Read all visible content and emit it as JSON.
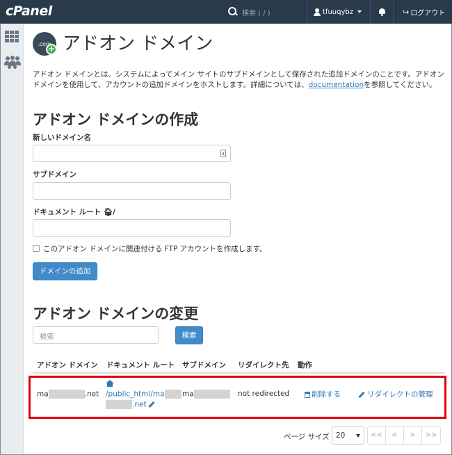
{
  "header": {
    "logo": "cPanel",
    "search_placeholder": "検索 ( / )",
    "username": "tfuuqybz",
    "logout_label": "ログアウト"
  },
  "page": {
    "title": "アドオン ドメイン",
    "icon_text": ".com",
    "intro_text": "アドオン ドメインとは、システムによってメイン サイトのサブドメインとして保存された追加ドメインのことです。アドオン ドメインを使用して、アカウントの追加ドメインをホストします。詳細については、",
    "intro_link": "documentation",
    "intro_suffix": "を参照してください。"
  },
  "create": {
    "title": "アドオン ドメインの作成",
    "domain_label": "新しいドメイン名",
    "subdomain_label": "サブドメイン",
    "docroot_label": "ドキュメント ルート",
    "docroot_suffix": "/",
    "ftp_checkbox_label": "このアドオン ドメインに関連付ける FTP アカウントを作成します。",
    "add_button": "ドメインの追加"
  },
  "modify": {
    "title": "アドオン ドメインの変更",
    "search_placeholder": "検索",
    "search_button": "検索",
    "columns": [
      "アドオン ドメイン",
      "ドキュメント ルート",
      "サブドメイン",
      "リダイレクト先",
      "動作"
    ],
    "row": {
      "domain_prefix": "ma",
      "domain_suffix": ".net",
      "docroot_line1": "/public_html/ma",
      "docroot_line2_suffix": ".net",
      "subdomain_prefix": "ma",
      "redirect": "not redirected",
      "delete_label": "削除する",
      "manage_redirect_label": "リダイレクトの管理"
    },
    "page_size_label": "ページ サイズ",
    "page_size_value": "20",
    "pager": [
      "<<",
      "<",
      ">",
      ">>"
    ]
  },
  "colors": {
    "header_bg": "#293a4a",
    "primary": "#428bca",
    "link": "#337ab7",
    "highlight": "#e3000f"
  }
}
